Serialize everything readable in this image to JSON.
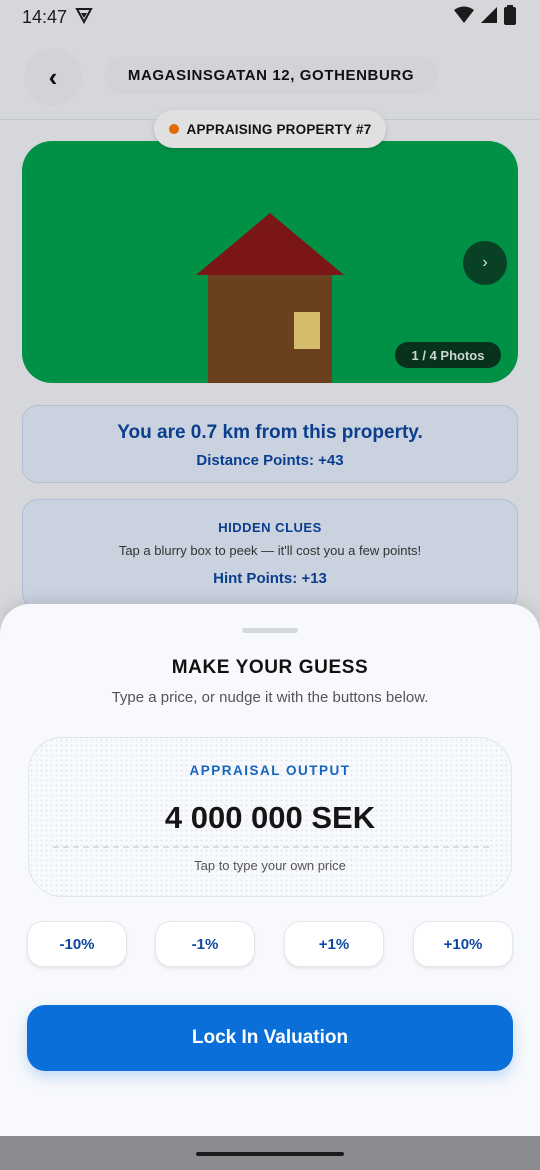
{
  "status_bar": {
    "time": "14:47",
    "icons": [
      "shield-status-icon",
      "wifi-icon",
      "signal-icon",
      "battery-icon"
    ]
  },
  "header": {
    "back_icon": "‹",
    "address": "MAGASINSGATAN 12, GOTHENBURG"
  },
  "badge": {
    "label": "APPRAISING PROPERTY #7",
    "dot_color": "#ff7a00"
  },
  "photo": {
    "next_icon": "›",
    "count": "1 / 4 Photos",
    "background_color": "#00a651"
  },
  "distance": {
    "text": "You are 0.7 km from this property.",
    "points": "Distance Points: +43"
  },
  "clues": {
    "title": "HIDDEN CLUES",
    "description": "Tap a blurry box to peek — it'll cost you a few points!",
    "points": "Hint Points: +13"
  },
  "guess_sheet": {
    "title": "MAKE YOUR GUESS",
    "subtitle": "Type a price, or nudge it with the buttons below.",
    "output_label": "APPRAISAL OUTPUT",
    "output_value": "4 000 000 SEK",
    "output_hint": "Tap to type your own price",
    "adjust_buttons": [
      "-10%",
      "-1%",
      "+1%",
      "+10%"
    ],
    "submit_label": "Lock In Valuation",
    "accent_color": "#0b6fd9"
  }
}
